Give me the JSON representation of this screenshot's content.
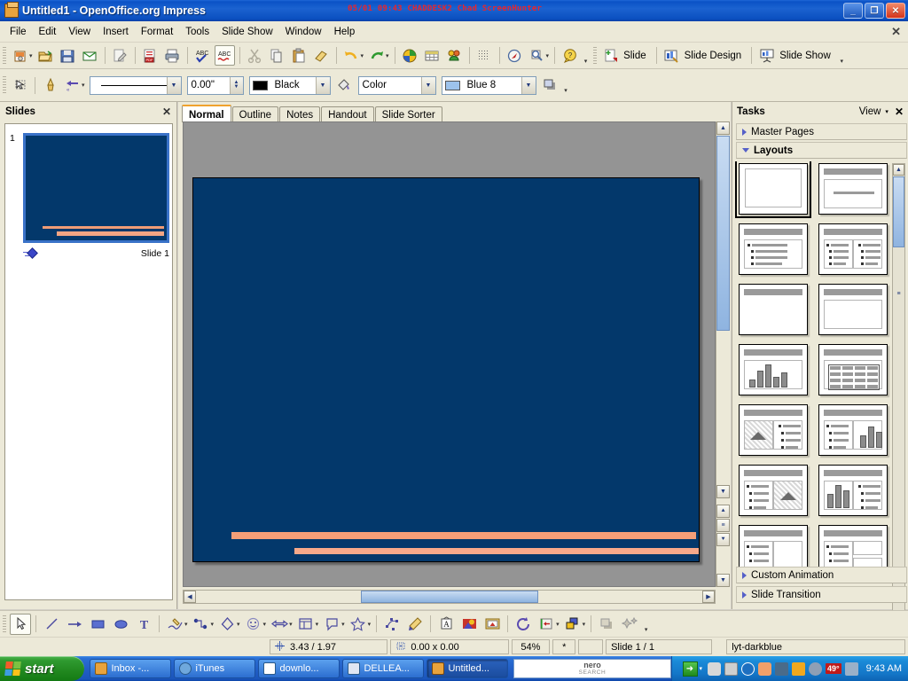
{
  "window": {
    "title": "Untitled1  -  OpenOffice.org Impress",
    "app_icon": "impress-icon",
    "timestamp_overlay": "05/01 09:43 CHADDESK2 Chad ScreenHunter",
    "minimize_label": "_",
    "maximize_label": "❐",
    "close_label": "✕"
  },
  "menubar": {
    "items": [
      {
        "label": "File"
      },
      {
        "label": "Edit"
      },
      {
        "label": "View"
      },
      {
        "label": "Insert"
      },
      {
        "label": "Format"
      },
      {
        "label": "Tools"
      },
      {
        "label": "Slide Show"
      },
      {
        "label": "Window"
      },
      {
        "label": "Help"
      }
    ],
    "close_doc_label": "✕"
  },
  "toolbar_standard": {
    "buttons": [
      {
        "name": "new-document-icon",
        "glyph": "❐",
        "dropdown": true
      },
      {
        "name": "open-icon",
        "glyph": "📂"
      },
      {
        "name": "save-icon",
        "glyph": "💾"
      },
      {
        "name": "email-document-icon",
        "glyph": "✉"
      },
      {
        "name": "edit-file-icon",
        "glyph": "📝"
      },
      {
        "name": "export-pdf-icon",
        "glyph": "📄"
      },
      {
        "name": "print-icon",
        "glyph": "🖨"
      },
      {
        "name": "spelling-icon",
        "glyph": "ABC"
      },
      {
        "name": "autospellcheck-icon",
        "glyph": "ABC"
      },
      {
        "name": "cut-icon",
        "glyph": "✂"
      },
      {
        "name": "copy-icon",
        "glyph": "⧉"
      },
      {
        "name": "paste-icon",
        "glyph": "📋"
      },
      {
        "name": "clone-formatting-icon",
        "glyph": "🖌"
      },
      {
        "name": "undo-icon",
        "glyph": "↶",
        "dropdown": true
      },
      {
        "name": "redo-icon",
        "glyph": "↷",
        "dropdown": true
      },
      {
        "name": "chart-icon",
        "glyph": "◕"
      },
      {
        "name": "table-icon",
        "glyph": "▦"
      },
      {
        "name": "gallery-icon",
        "glyph": "⚘"
      },
      {
        "name": "display-grid-icon",
        "glyph": "▒"
      },
      {
        "name": "hyperlink-icon",
        "glyph": "🧭"
      },
      {
        "name": "zoom-icon",
        "glyph": "🔍",
        "dropdown": true
      },
      {
        "name": "help-icon",
        "glyph": "?"
      }
    ],
    "presentation_buttons": [
      {
        "label": "Slide",
        "icon": "new-slide-icon"
      },
      {
        "label": "Slide Design",
        "icon": "slide-design-icon"
      },
      {
        "label": "Slide Show",
        "icon": "slide-show-icon"
      }
    ],
    "overflow_label": "▾"
  },
  "toolbar_line_fill": {
    "select_icon": "select-tool-icon",
    "line_icon": "line-properties-icon",
    "arrow_style_icon": "arrow-style-icon",
    "line_style": {
      "value": "—————",
      "name": "line-style-dropdown"
    },
    "line_width": {
      "value": "0.00\"",
      "name": "line-width-field"
    },
    "line_color": {
      "value": "Black",
      "swatch": "#000000"
    },
    "area_icon": "area-style-icon",
    "fill_type": {
      "value": "Color"
    },
    "fill_color": {
      "value": "Blue 8",
      "swatch": "#9dc3ec"
    },
    "shadow_icon": "shadow-icon",
    "overflow_label": "▾"
  },
  "slides_panel": {
    "title": "Slides",
    "close_label": "✕",
    "slides": [
      {
        "number": "1",
        "name": "Slide 1",
        "background": "#03386b",
        "transition_icon": "slide-transition-icon"
      }
    ]
  },
  "view_tabs": {
    "tabs": [
      {
        "label": "Normal",
        "selected": true
      },
      {
        "label": "Outline",
        "selected": false
      },
      {
        "label": "Notes",
        "selected": false
      },
      {
        "label": "Handout",
        "selected": false
      },
      {
        "label": "Slide Sorter",
        "selected": false
      }
    ]
  },
  "canvas": {
    "slide_bg": "#03386b",
    "accent_bar_color": "#f59f78",
    "workspace_bg": "#949494"
  },
  "tasks_panel": {
    "title": "Tasks",
    "view_label": "View",
    "view_dropdown_label": "▾",
    "close_label": "✕",
    "sections": [
      {
        "label": "Master Pages",
        "open": false
      },
      {
        "label": "Layouts",
        "open": true
      },
      {
        "label": "Custom Animation",
        "open": false
      },
      {
        "label": "Slide Transition",
        "open": false
      }
    ],
    "layouts": [
      {
        "name": "layout-blank",
        "type": "blank",
        "selected": true
      },
      {
        "name": "layout-title-content",
        "type": "title-subtitle",
        "selected": false
      },
      {
        "name": "layout-title-bullets",
        "type": "title-bullets",
        "selected": false
      },
      {
        "name": "layout-title-two-bullets",
        "type": "title-two-bullets",
        "selected": false
      },
      {
        "name": "layout-title-only",
        "type": "title-only",
        "selected": false
      },
      {
        "name": "layout-title-blank-box",
        "type": "title-box",
        "selected": false
      },
      {
        "name": "layout-title-chart",
        "type": "title-chart",
        "selected": false
      },
      {
        "name": "layout-title-table",
        "type": "title-table",
        "selected": false
      },
      {
        "name": "layout-title-clipart-bullets",
        "type": "clipart-bullets",
        "selected": false
      },
      {
        "name": "layout-title-bullets-chart",
        "type": "bullets-chart",
        "selected": false
      },
      {
        "name": "layout-title-bullets-clipart",
        "type": "bullets-clipart",
        "selected": false
      },
      {
        "name": "layout-title-chart-bullets",
        "type": "chart-bullets",
        "selected": false
      },
      {
        "name": "layout-title-bullets-box",
        "type": "bullets-box",
        "selected": false
      },
      {
        "name": "layout-title-bullets-two-box",
        "type": "bullets-two-box",
        "selected": false
      }
    ]
  },
  "drawing_toolbar": {
    "buttons": [
      {
        "name": "select-tool-icon",
        "glyph": "➤",
        "active": true
      },
      {
        "name": "line-tool-icon",
        "glyph": "╱"
      },
      {
        "name": "arrow-tool-icon",
        "glyph": "→"
      },
      {
        "name": "rectangle-tool-icon",
        "glyph": "▬"
      },
      {
        "name": "ellipse-tool-icon",
        "glyph": "⬬"
      },
      {
        "name": "text-tool-icon",
        "glyph": "T"
      },
      {
        "name": "curve-tool-icon",
        "glyph": "✎",
        "dropdown": true
      },
      {
        "name": "connector-tool-icon",
        "glyph": "∴",
        "dropdown": true
      },
      {
        "name": "basic-shapes-icon",
        "glyph": "◇",
        "dropdown": true
      },
      {
        "name": "symbol-shapes-icon",
        "glyph": "☺",
        "dropdown": true
      },
      {
        "name": "block-arrows-icon",
        "glyph": "⇔",
        "dropdown": true
      },
      {
        "name": "flowchart-shapes-icon",
        "glyph": "◱",
        "dropdown": true
      },
      {
        "name": "callout-shapes-icon",
        "glyph": "💬",
        "dropdown": true
      },
      {
        "name": "stars-shapes-icon",
        "glyph": "☆",
        "dropdown": true
      },
      {
        "name": "points-icon",
        "glyph": "⁙"
      },
      {
        "name": "gluepoints-icon",
        "glyph": "✒"
      },
      {
        "name": "fontwork-icon",
        "glyph": "A"
      },
      {
        "name": "insert-image-icon",
        "glyph": "◢"
      },
      {
        "name": "insert-chart-icon",
        "glyph": "⌂"
      },
      {
        "name": "rotate-icon",
        "glyph": "↻"
      },
      {
        "name": "alignment-icon",
        "glyph": "⇤",
        "dropdown": true
      },
      {
        "name": "arrange-icon",
        "glyph": "❐",
        "dropdown": true
      },
      {
        "name": "shadow-toggle-icon",
        "glyph": "◰"
      },
      {
        "name": "interaction-icon",
        "glyph": "✨"
      }
    ],
    "overflow_label": "▾"
  },
  "statusbar": {
    "cursor_position": "3.43 / 1.97",
    "object_size": "0.00 x 0.00",
    "zoom": "54%",
    "modified": "*",
    "signature": "",
    "slide_counter": "Slide 1 / 1",
    "master_page": "lyt-darkblue",
    "position_icon": "cursor-position-icon",
    "size_icon": "object-size-icon"
  },
  "taskbar": {
    "start_label": "start",
    "items": [
      {
        "label": "Inbox -...",
        "icon_color": "#e8a33d",
        "selected": false
      },
      {
        "label": "iTunes",
        "icon_color": "#6fa8dc",
        "selected": false
      },
      {
        "label": "downlo...",
        "icon_color": "#3c8de0",
        "selected": false
      },
      {
        "label": "DELLEA...",
        "icon_color": "#4a6fb5",
        "selected": false
      },
      {
        "label": "Untitled...",
        "icon_color": "#e8a33d",
        "selected": true
      }
    ],
    "search_box": {
      "brand": "nero",
      "sub": "SEARCH"
    },
    "tray_icons": [
      {
        "name": "go-arrow-icon",
        "color": "#2f9a30"
      },
      {
        "name": "tray-dropdown-icon",
        "color": "#1a55bb"
      },
      {
        "name": "microphone-icon",
        "color": "#d8d8d8"
      },
      {
        "name": "battery-icon",
        "color": "#cccccc"
      },
      {
        "name": "back-arrow-icon",
        "color": "#1d6fc0"
      },
      {
        "name": "hand-icon",
        "color": "#f2a06a"
      },
      {
        "name": "network-icon",
        "color": "#4a6b8a"
      },
      {
        "name": "clock-icon",
        "color": "#f0a81e"
      },
      {
        "name": "media-icon",
        "color": "#8f9fb5"
      }
    ],
    "temperature": "49°",
    "user_icon": "user-icon",
    "clock": "9:43 AM"
  }
}
